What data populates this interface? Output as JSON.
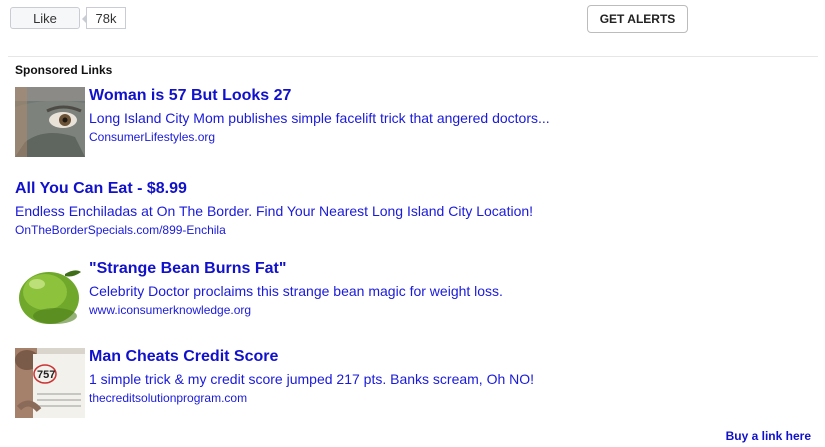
{
  "social": {
    "like_label": "Like",
    "like_count": "78k"
  },
  "alerts": {
    "label": "GET ALERTS"
  },
  "sponsored": {
    "heading": "Sponsored Links",
    "ads": [
      {
        "title": "Woman is 57 But Looks 27",
        "description": "Long Island City Mom publishes simple facelift trick that angered doctors...",
        "url": "ConsumerLifestyles.org",
        "thumbnail": "face-mask-photo"
      },
      {
        "title": "All You Can Eat - $8.99",
        "description": "Endless Enchiladas at On The Border. Find Your Nearest Long Island City Location!",
        "url": "OnTheBorderSpecials.com/899-Enchila"
      },
      {
        "title": "\"Strange Bean Burns Fat\"",
        "description": "Celebrity Doctor proclaims this strange bean magic for weight loss.",
        "url": "www.iconsumerknowledge.org",
        "thumbnail": "green-fruit-photo"
      },
      {
        "title": "Man Cheats Credit Score",
        "description": "1 simple trick & my credit score jumped 217 pts. Banks scream, Oh NO!",
        "url": "thecreditsolutionprogram.com",
        "thumbnail": "credit-score-photo",
        "thumbnail_text": "757"
      }
    ],
    "buy_link": "Buy a link here"
  },
  "colors": {
    "link": "#1111cc",
    "text_link": "#1a1adb"
  }
}
